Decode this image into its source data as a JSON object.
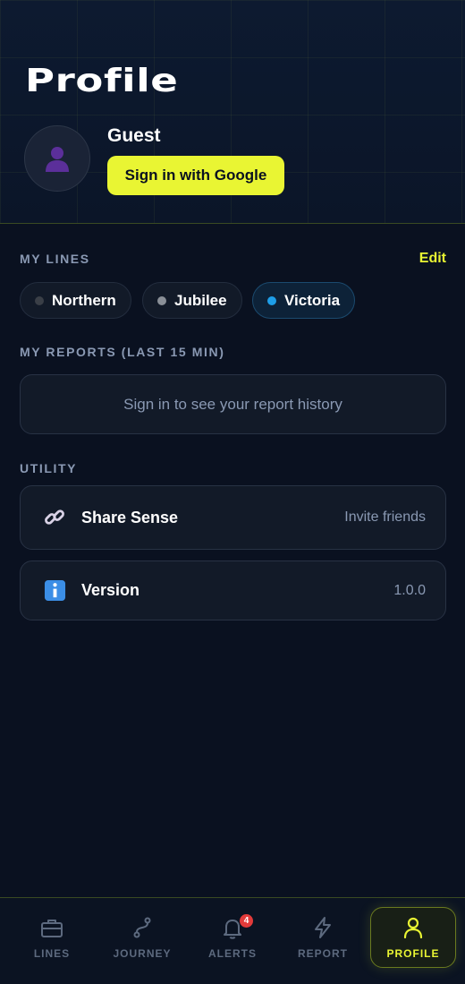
{
  "header": {
    "title": "Profile",
    "user_name": "Guest",
    "sign_in_label": "Sign in with Google"
  },
  "my_lines": {
    "label": "MY LINES",
    "edit_label": "Edit",
    "lines": [
      {
        "name": "Northern",
        "color": "#3a3f47",
        "selected": false
      },
      {
        "name": "Jubilee",
        "color": "#8a8f97",
        "selected": false
      },
      {
        "name": "Victoria",
        "color": "#1e9ee8",
        "selected": true
      }
    ]
  },
  "my_reports": {
    "label": "MY REPORTS (LAST 15 MIN)",
    "empty_text": "Sign in to see your report history"
  },
  "utility": {
    "label": "UTILITY",
    "items": [
      {
        "icon": "link-icon",
        "title": "Share Sense",
        "value": "Invite friends"
      },
      {
        "icon": "info-icon",
        "title": "Version",
        "value": "1.0.0"
      }
    ]
  },
  "nav": {
    "items": [
      {
        "label": "LINES",
        "icon": "toolbox-icon",
        "active": false
      },
      {
        "label": "JOURNEY",
        "icon": "route-icon",
        "active": false
      },
      {
        "label": "ALERTS",
        "icon": "bell-icon",
        "active": false,
        "badge": "4"
      },
      {
        "label": "REPORT",
        "icon": "bolt-icon",
        "active": false
      },
      {
        "label": "PROFILE",
        "icon": "user-icon",
        "active": true
      }
    ]
  },
  "colors": {
    "accent": "#e9f533",
    "background": "#0a1120",
    "muted_text": "#8a99b3"
  }
}
